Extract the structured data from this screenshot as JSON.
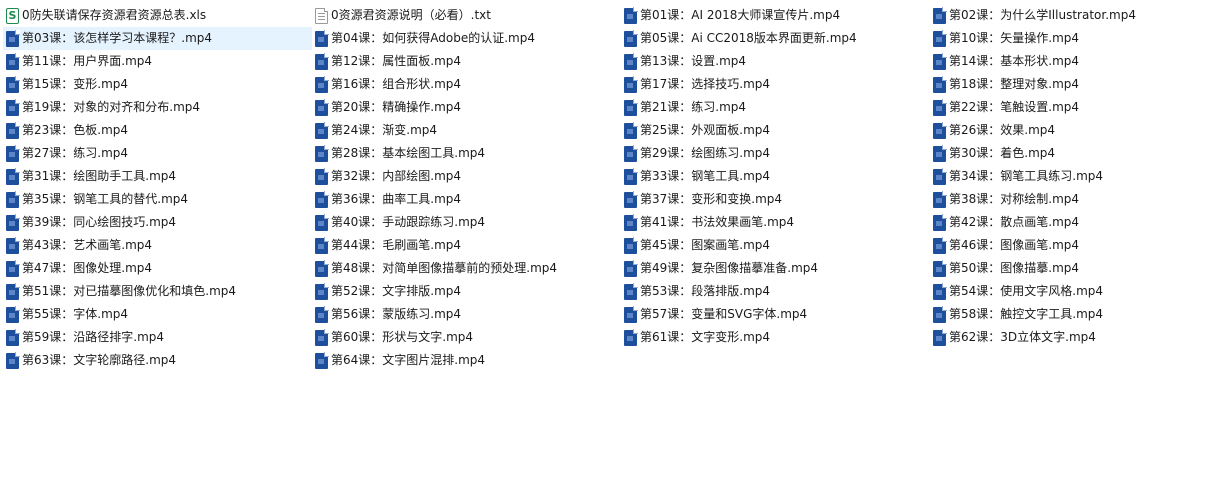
{
  "files": [
    {
      "name": "0防失联请保存资源君资源总表.xls",
      "type": "xls",
      "icon": "S"
    },
    {
      "name": "0资源君资源说明（必看）.txt",
      "type": "txt"
    },
    {
      "name": "第01课：AI 2018大师课宣传片.mp4",
      "type": "mp4"
    },
    {
      "name": "第02课：为什么学Illustrator.mp4",
      "type": "mp4"
    },
    {
      "name": "第03课：该怎样学习本课程？.mp4",
      "type": "mp4",
      "selected": true
    },
    {
      "name": "第04课：如何获得Adobe的认证.mp4",
      "type": "mp4"
    },
    {
      "name": "第05课：Ai CC2018版本界面更新.mp4",
      "type": "mp4"
    },
    {
      "name": "第10课：矢量操作.mp4",
      "type": "mp4"
    },
    {
      "name": "第11课：用户界面.mp4",
      "type": "mp4"
    },
    {
      "name": "第12课：属性面板.mp4",
      "type": "mp4"
    },
    {
      "name": "第13课：设置.mp4",
      "type": "mp4"
    },
    {
      "name": "第14课：基本形状.mp4",
      "type": "mp4"
    },
    {
      "name": "第15课：变形.mp4",
      "type": "mp4"
    },
    {
      "name": "第16课：组合形状.mp4",
      "type": "mp4"
    },
    {
      "name": "第17课：选择技巧.mp4",
      "type": "mp4"
    },
    {
      "name": "第18课：整理对象.mp4",
      "type": "mp4"
    },
    {
      "name": "第19课：对象的对齐和分布.mp4",
      "type": "mp4"
    },
    {
      "name": "第20课：精确操作.mp4",
      "type": "mp4"
    },
    {
      "name": "第21课：练习.mp4",
      "type": "mp4"
    },
    {
      "name": "第22课：笔触设置.mp4",
      "type": "mp4"
    },
    {
      "name": "第23课：色板.mp4",
      "type": "mp4"
    },
    {
      "name": "第24课：渐变.mp4",
      "type": "mp4"
    },
    {
      "name": "第25课：外观面板.mp4",
      "type": "mp4"
    },
    {
      "name": "第26课：效果.mp4",
      "type": "mp4"
    },
    {
      "name": "第27课：练习.mp4",
      "type": "mp4"
    },
    {
      "name": "第28课：基本绘图工具.mp4",
      "type": "mp4"
    },
    {
      "name": "第29课：绘图练习.mp4",
      "type": "mp4"
    },
    {
      "name": "第30课：着色.mp4",
      "type": "mp4"
    },
    {
      "name": "第31课：绘图助手工具.mp4",
      "type": "mp4"
    },
    {
      "name": "第32课：内部绘图.mp4",
      "type": "mp4"
    },
    {
      "name": "第33课：钢笔工具.mp4",
      "type": "mp4"
    },
    {
      "name": "第34课：钢笔工具练习.mp4",
      "type": "mp4"
    },
    {
      "name": "第35课：钢笔工具的替代.mp4",
      "type": "mp4"
    },
    {
      "name": "第36课：曲率工具.mp4",
      "type": "mp4"
    },
    {
      "name": "第37课：变形和变换.mp4",
      "type": "mp4"
    },
    {
      "name": "第38课：对称绘制.mp4",
      "type": "mp4"
    },
    {
      "name": "第39课：同心绘图技巧.mp4",
      "type": "mp4"
    },
    {
      "name": "第40课：手动跟踪练习.mp4",
      "type": "mp4"
    },
    {
      "name": "第41课：书法效果画笔.mp4",
      "type": "mp4"
    },
    {
      "name": "第42课：散点画笔.mp4",
      "type": "mp4"
    },
    {
      "name": "第43课：艺术画笔.mp4",
      "type": "mp4"
    },
    {
      "name": "第44课：毛刷画笔.mp4",
      "type": "mp4"
    },
    {
      "name": "第45课：图案画笔.mp4",
      "type": "mp4"
    },
    {
      "name": "第46课：图像画笔.mp4",
      "type": "mp4"
    },
    {
      "name": "第47课：图像处理.mp4",
      "type": "mp4"
    },
    {
      "name": "第48课：对简单图像描摹前的预处理.mp4",
      "type": "mp4"
    },
    {
      "name": "第49课：复杂图像描摹准备.mp4",
      "type": "mp4"
    },
    {
      "name": "第50课：图像描摹.mp4",
      "type": "mp4"
    },
    {
      "name": "第51课：对已描摹图像优化和填色.mp4",
      "type": "mp4"
    },
    {
      "name": "第52课：文字排版.mp4",
      "type": "mp4"
    },
    {
      "name": "第53课：段落排版.mp4",
      "type": "mp4"
    },
    {
      "name": "第54课：使用文字风格.mp4",
      "type": "mp4"
    },
    {
      "name": "第55课：字体.mp4",
      "type": "mp4"
    },
    {
      "name": "第56课：蒙版练习.mp4",
      "type": "mp4"
    },
    {
      "name": "第57课：变量和SVG字体.mp4",
      "type": "mp4"
    },
    {
      "name": "第58课：触控文字工具.mp4",
      "type": "mp4"
    },
    {
      "name": "第59课：沿路径排字.mp4",
      "type": "mp4"
    },
    {
      "name": "第60课：形状与文字.mp4",
      "type": "mp4"
    },
    {
      "name": "第61课：文字变形.mp4",
      "type": "mp4"
    },
    {
      "name": "第62课：3D立体文字.mp4",
      "type": "mp4"
    },
    {
      "name": "第63课：文字轮廓路径.mp4",
      "type": "mp4"
    },
    {
      "name": "第64课：文字图片混排.mp4",
      "type": "mp4"
    }
  ],
  "colors": {
    "selection": "#e5f3ff",
    "video_icon": "#1e4f9c",
    "xls_icon": "#1d8a4e",
    "txt_icon": "#9a9a9a"
  }
}
